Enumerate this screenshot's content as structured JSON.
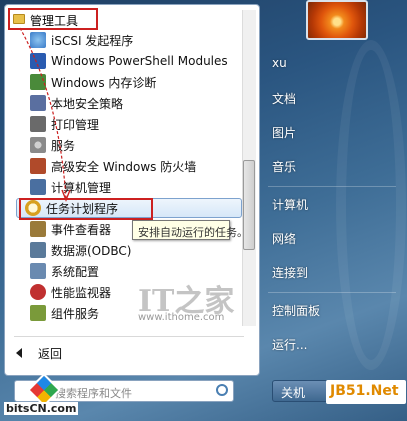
{
  "folder": {
    "label": "管理工具"
  },
  "items": [
    {
      "label": "iSCSI 发起程序",
      "icon": "globe-icon",
      "color": "#3a7bc8"
    },
    {
      "label": "Windows PowerShell Modules",
      "icon": "powershell-icon",
      "color": "#2a5bb0"
    },
    {
      "label": "Windows 内存诊断",
      "icon": "memory-chip-icon",
      "color": "#4a8a3a"
    },
    {
      "label": "本地安全策略",
      "icon": "security-policy-icon",
      "color": "#5a6fa0"
    },
    {
      "label": "打印管理",
      "icon": "printer-icon",
      "color": "#6a6a6a"
    },
    {
      "label": "服务",
      "icon": "gear-icon",
      "color": "#8a8a8a"
    },
    {
      "label": "高级安全 Windows 防火墙",
      "icon": "firewall-icon",
      "color": "#b04a2a"
    },
    {
      "label": "计算机管理",
      "icon": "computer-management-icon",
      "color": "#4a6fa0"
    },
    {
      "label": "任务计划程序",
      "icon": "clock-icon",
      "color": "#d8a020"
    },
    {
      "label": "事件查看器",
      "icon": "event-viewer-icon",
      "color": "#9a7a3a"
    },
    {
      "label": "数据源(ODBC)",
      "icon": "database-icon",
      "color": "#5a7a9a"
    },
    {
      "label": "系统配置",
      "icon": "system-config-icon",
      "color": "#6a8ab0"
    },
    {
      "label": "性能监视器",
      "icon": "performance-icon",
      "color": "#c03030"
    },
    {
      "label": "组件服务",
      "icon": "component-services-icon",
      "color": "#7a9a3a"
    }
  ],
  "tooltip": "安排自动运行的任务。",
  "back_label": "返回",
  "search_placeholder": "搜索程序和文件",
  "right_items": [
    "xu",
    "文档",
    "图片",
    "音乐",
    "计算机",
    "网络",
    "连接到",
    "控制面板",
    "运行..."
  ],
  "shutdown_label": "关机",
  "watermark": {
    "mark": "IT之家",
    "url": "www.ithome.com"
  },
  "bitscn_label": "bitsCN.com",
  "jb51_label": "JB51.Net"
}
